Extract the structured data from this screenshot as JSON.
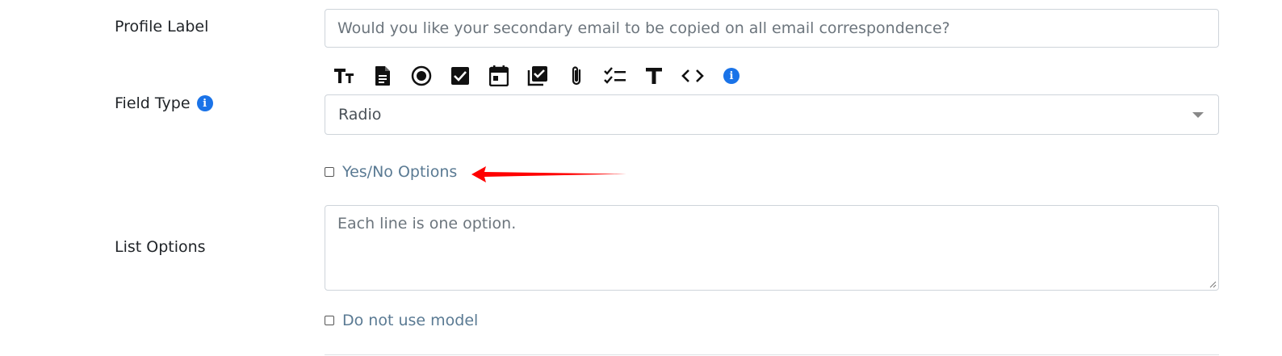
{
  "form": {
    "profile_label": {
      "label": "Profile Label",
      "placeholder": "Would you like your secondary email to be copied on all email correspondence?"
    },
    "field_type": {
      "label": "Field Type",
      "selected": "Radio",
      "toolbar_icons": [
        "text-size-icon",
        "document-icon",
        "radio-icon",
        "checkbox-icon",
        "calendar-icon",
        "checkbox-multiple-icon",
        "attachment-icon",
        "checklist-icon",
        "text-icon",
        "code-icon",
        "info-icon"
      ]
    },
    "yes_no": {
      "label": "Yes/No Options",
      "checked": false
    },
    "list_options": {
      "label": "List Options",
      "placeholder": "Each line is one option."
    },
    "do_not_use_model": {
      "label": "Do not use model",
      "checked": false
    }
  },
  "colors": {
    "info_blue": "#1a73e8",
    "checkbox_label": "#5a7a93",
    "annotation_arrow": "#ff0000"
  }
}
